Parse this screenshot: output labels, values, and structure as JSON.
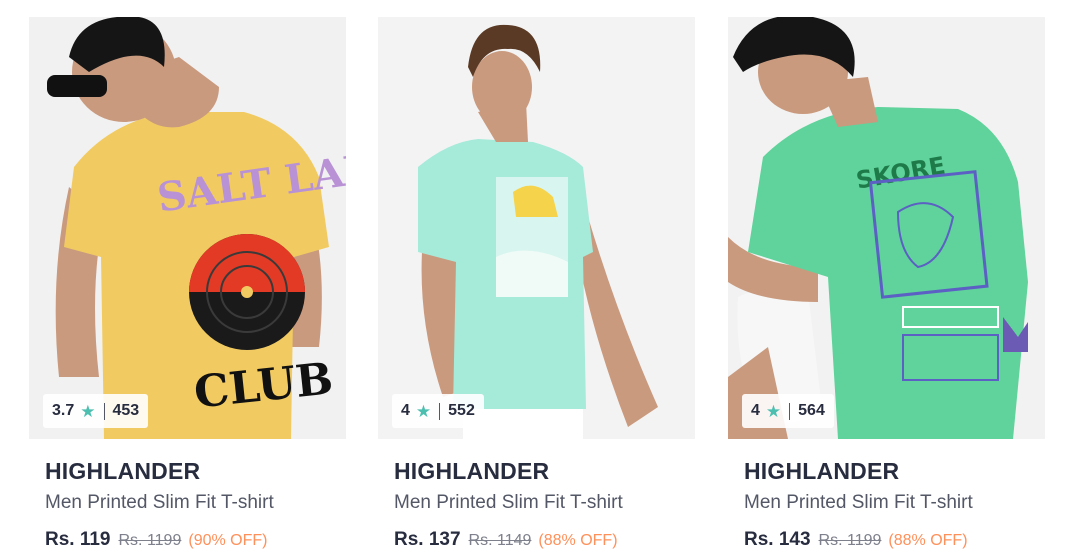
{
  "products": [
    {
      "brand": "HIGHLANDER",
      "name": "Men Printed Slim Fit T-shirt",
      "price": "Rs. 119",
      "mrp": "Rs. 1199",
      "discount": "(90% OFF)",
      "rating": "3.7",
      "rating_count": "453",
      "tshirt_color": "#f1cb62",
      "image_icon": "model-yellow-tshirt-image",
      "print_text_top": "SALT LAKE",
      "print_text_bottom": "CLUB"
    },
    {
      "brand": "HIGHLANDER",
      "name": "Men Printed Slim Fit T-shirt",
      "price": "Rs. 137",
      "mrp": "Rs. 1149",
      "discount": "(88% OFF)",
      "rating": "4",
      "rating_count": "552",
      "tshirt_color": "#a6ead9",
      "image_icon": "model-aqua-tshirt-image"
    },
    {
      "brand": "HIGHLANDER",
      "name": "Men Printed Slim Fit T-shirt",
      "price": "Rs. 143",
      "mrp": "Rs. 1199",
      "discount": "(88% OFF)",
      "rating": "4",
      "rating_count": "564",
      "tshirt_color": "#5fd39b",
      "image_icon": "model-green-tshirt-image",
      "print_text_top": "SKORE"
    }
  ],
  "colors": {
    "star": "#4dbfb0",
    "discount": "#ff905a",
    "brand_text": "#282c3f",
    "secondary_text": "#535766"
  },
  "icons": {
    "rating_star": "star-icon"
  }
}
